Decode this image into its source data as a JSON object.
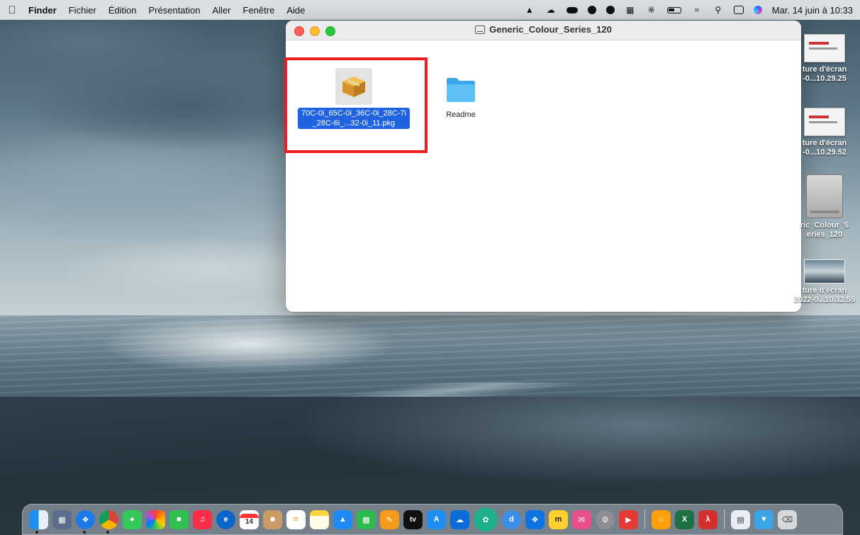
{
  "menubar": {
    "app": "Finder",
    "items": [
      "Fichier",
      "Édition",
      "Présentation",
      "Aller",
      "Fenêtre",
      "Aide"
    ],
    "clock": "Mar. 14 juin à 10:33"
  },
  "window": {
    "title": "Generic_Colour_Series_120",
    "files": [
      {
        "name": "70C-0i_65C-0i_36C-0i_28C-7i_28C-6i_...32-0i_11.pkg",
        "kind": "package-icon",
        "selected": true
      },
      {
        "name": "Readme",
        "kind": "folder-icon",
        "selected": false
      }
    ]
  },
  "desktop": {
    "items": [
      {
        "label": "ture d'écran\n-0...10.29.25",
        "kind": "screenshot-thumbnail"
      },
      {
        "label": "ture d'écran\n-0...10.29.52",
        "kind": "screenshot-thumbnail"
      },
      {
        "label": "ric_Colour_S\neries_120",
        "kind": "disk-image-icon"
      },
      {
        "label": "ture d'écran\n2022-0...10.32.55",
        "kind": "screenshot-thumbnail"
      }
    ]
  },
  "dock": {
    "apps": [
      "finder",
      "launchpad",
      "safari",
      "chrome",
      "messages",
      "photos",
      "facetime",
      "music",
      "edge-app",
      "calendar",
      "contacts",
      "reminders",
      "notes",
      "keynote",
      "numbers",
      "pages",
      "apple-tv",
      "app-store",
      "onedrive",
      "brain-app",
      "dashlane",
      "teamviewer",
      "miro",
      "mail-app",
      "system-preferences",
      "fxa",
      "home",
      "excel",
      "acrobat",
      "preview",
      "downloads-folder",
      "trash"
    ],
    "calendar_day": "14",
    "tv_label": "tv"
  }
}
